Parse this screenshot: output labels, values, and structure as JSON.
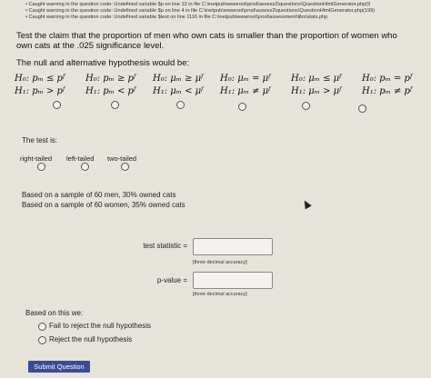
{
  "warnings": [
    "Caught warning in the question code: Undefined variable $p on line 13 in file C:\\inetpub\\wwwroot\\prod\\assess2\\questions\\QuestionHtmlGenerator.php(9",
    "Caught warning in the question code: Undefined variable $p on line 4 in file C:\\inetpub\\wwwroot\\prod\\assess2\\questions\\QuestionHtmlGenerator.php(199)",
    "Caught warning in the question code: Undefined variable $test on line 1116 in file C:\\inetpub\\wwwroot\\prod\\assessment\\libs\\stats.php"
  ],
  "question": {
    "claim": "Test the claim that the proportion of men who own cats is smaller than the proportion of women who own cats at the .025 significance level.",
    "hypotheses_title": "The null and alternative hypothesis would be:",
    "hypotheses": [
      {
        "h0": "H₀: pₘ ≤ pᶠ",
        "h1": "H₁: pₘ > pᶠ"
      },
      {
        "h0": "H₀: pₘ ≥ pᶠ",
        "h1": "H₁: pₘ < pᶠ"
      },
      {
        "h0": "H₀: μₘ ≥ μᶠ",
        "h1": "H₁: μₘ < μᶠ"
      },
      {
        "h0": "H₀: μₘ = μᶠ",
        "h1": "H₁: μₘ ≠ μᶠ"
      },
      {
        "h0": "H₀: μₘ ≤ μᶠ",
        "h1": "H₁: μₘ > μᶠ"
      },
      {
        "h0": "H₀: pₘ = pᶠ",
        "h1": "H₁: pₘ ≠ pᶠ"
      }
    ],
    "test_label": "The test is:",
    "tails": [
      "right-tailed",
      "left-tailed",
      "two-tailed"
    ],
    "sample_men": "Based on a sample of 60 men, 30% owned cats",
    "sample_women": "Based on a sample of 60 women, 35% owned cats",
    "test_statistic_label": "test statistic =",
    "test_statistic_value": "",
    "pvalue_label": "p-value =",
    "pvalue_value": "",
    "accuracy_hint": "[three decimal accuracy]",
    "conclusion_label": "Based on this we:",
    "conclusions": [
      "Fail to reject the null hypothesis",
      "Reject the null hypothesis"
    ],
    "submit_label": "Submit Question"
  }
}
